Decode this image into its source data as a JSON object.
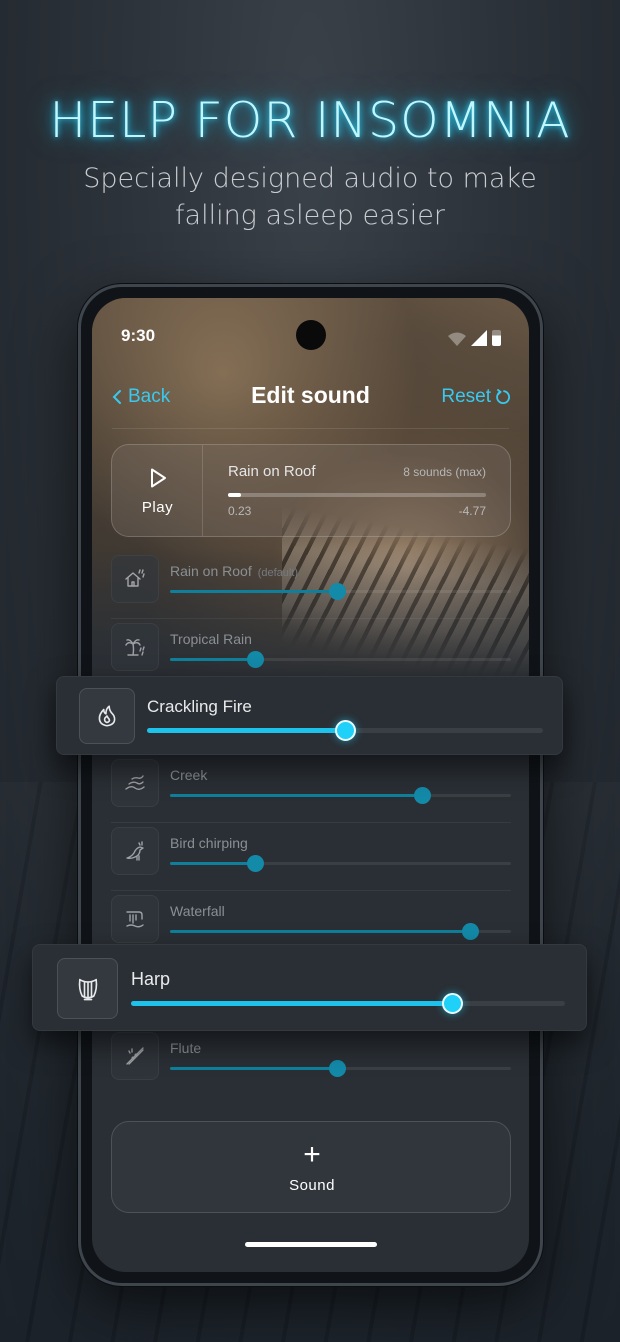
{
  "headline": "HELP FOR INSOMNIA",
  "subheadline": "Specially designed audio to make falling asleep easier",
  "status": {
    "time": "9:30"
  },
  "nav": {
    "back_label": "Back",
    "title": "Edit sound",
    "reset_label": "Reset"
  },
  "player": {
    "play_label": "Play",
    "mix_name": "Rain on Roof",
    "sounds_count": "8 sounds (max)",
    "start_value": "0.23",
    "end_value": "-4.77",
    "progress": 0.05
  },
  "sounds": [
    {
      "label": "Rain on Roof",
      "tag": "(default)",
      "icon": "house-rain-icon",
      "level": 0.49
    },
    {
      "label": "Tropical Rain",
      "icon": "palm-rain-icon",
      "level": 0.25
    },
    {
      "label": "Crackling Fire",
      "icon": "fire-icon",
      "level": 0.5,
      "highlighted": true
    },
    {
      "label": "Creek",
      "icon": "creek-waves-icon",
      "level": 0.74
    },
    {
      "label": "Bird chirping",
      "icon": "bird-icon",
      "level": 0.25
    },
    {
      "label": "Waterfall",
      "icon": "waterfall-icon",
      "level": 0.88
    },
    {
      "label": "Harp",
      "icon": "harp-icon",
      "level": 0.74,
      "highlighted": true
    },
    {
      "label": "Flute",
      "icon": "flute-icon",
      "level": 0.49
    }
  ],
  "add_button": {
    "plus": "+",
    "label": "Sound"
  },
  "colors": {
    "accent": "#39c9ef",
    "glow": "#1ec3ec"
  }
}
